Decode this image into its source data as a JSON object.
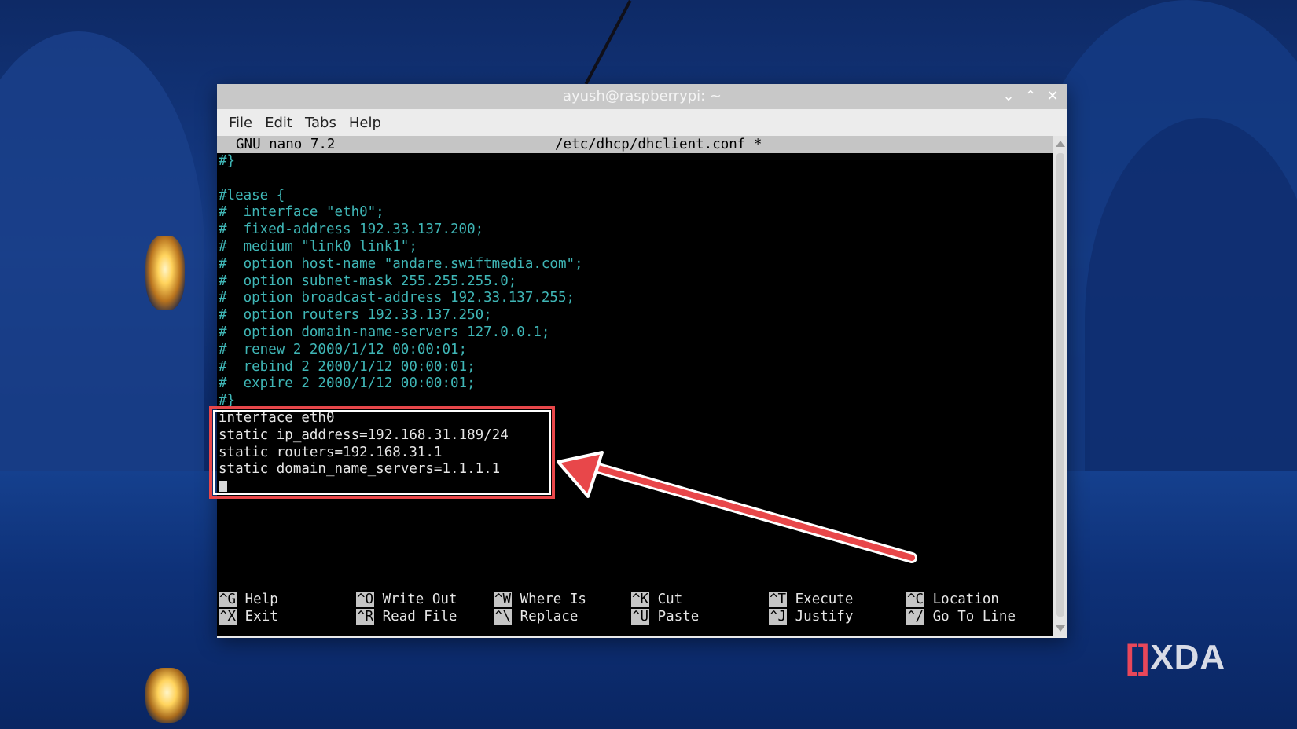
{
  "window": {
    "title": "ayush@raspberrypi: ~",
    "controls": {
      "minimize": "⌄",
      "maximize": "⌃",
      "close": "✕"
    }
  },
  "menubar": [
    "File",
    "Edit",
    "Tabs",
    "Help"
  ],
  "nano": {
    "app_version": "GNU nano 7.2",
    "filename": "/etc/dhcp/dhclient.conf *"
  },
  "editor_lines": [
    {
      "text": "#}",
      "kind": "comment"
    },
    {
      "text": "",
      "kind": "comment"
    },
    {
      "text": "#lease {",
      "kind": "comment"
    },
    {
      "text": "#  interface \"eth0\";",
      "kind": "comment"
    },
    {
      "text": "#  fixed-address 192.33.137.200;",
      "kind": "comment"
    },
    {
      "text": "#  medium \"link0 link1\";",
      "kind": "comment"
    },
    {
      "text": "#  option host-name \"andare.swiftmedia.com\";",
      "kind": "comment"
    },
    {
      "text": "#  option subnet-mask 255.255.255.0;",
      "kind": "comment"
    },
    {
      "text": "#  option broadcast-address 192.33.137.255;",
      "kind": "comment"
    },
    {
      "text": "#  option routers 192.33.137.250;",
      "kind": "comment"
    },
    {
      "text": "#  option domain-name-servers 127.0.0.1;",
      "kind": "comment"
    },
    {
      "text": "#  renew 2 2000/1/12 00:00:01;",
      "kind": "comment"
    },
    {
      "text": "#  rebind 2 2000/1/12 00:00:01;",
      "kind": "comment"
    },
    {
      "text": "#  expire 2 2000/1/12 00:00:01;",
      "kind": "comment"
    },
    {
      "text": "#}",
      "kind": "comment"
    },
    {
      "text": "interface eth0",
      "kind": "plain"
    },
    {
      "text": "static ip_address=192.168.31.189/24",
      "kind": "plain"
    },
    {
      "text": "static routers=192.168.31.1",
      "kind": "plain"
    },
    {
      "text": "static domain_name_servers=1.1.1.1",
      "kind": "plain"
    }
  ],
  "shortcuts": [
    [
      {
        "key": "^G",
        "label": "Help"
      },
      {
        "key": "^O",
        "label": "Write Out"
      },
      {
        "key": "^W",
        "label": "Where Is"
      },
      {
        "key": "^K",
        "label": "Cut"
      },
      {
        "key": "^T",
        "label": "Execute"
      },
      {
        "key": "^C",
        "label": "Location"
      }
    ],
    [
      {
        "key": "^X",
        "label": "Exit"
      },
      {
        "key": "^R",
        "label": "Read File"
      },
      {
        "key": "^\\",
        "label": "Replace"
      },
      {
        "key": "^U",
        "label": "Paste"
      },
      {
        "key": "^J",
        "label": "Justify"
      },
      {
        "key": "^/",
        "label": "Go To Line"
      }
    ]
  ],
  "watermark": {
    "bracket": "[]",
    "text": "XDA"
  },
  "colors": {
    "comment_text": "#3fb6b6",
    "plain_text": "#e6e6e6",
    "highlight": "#e8474a"
  }
}
